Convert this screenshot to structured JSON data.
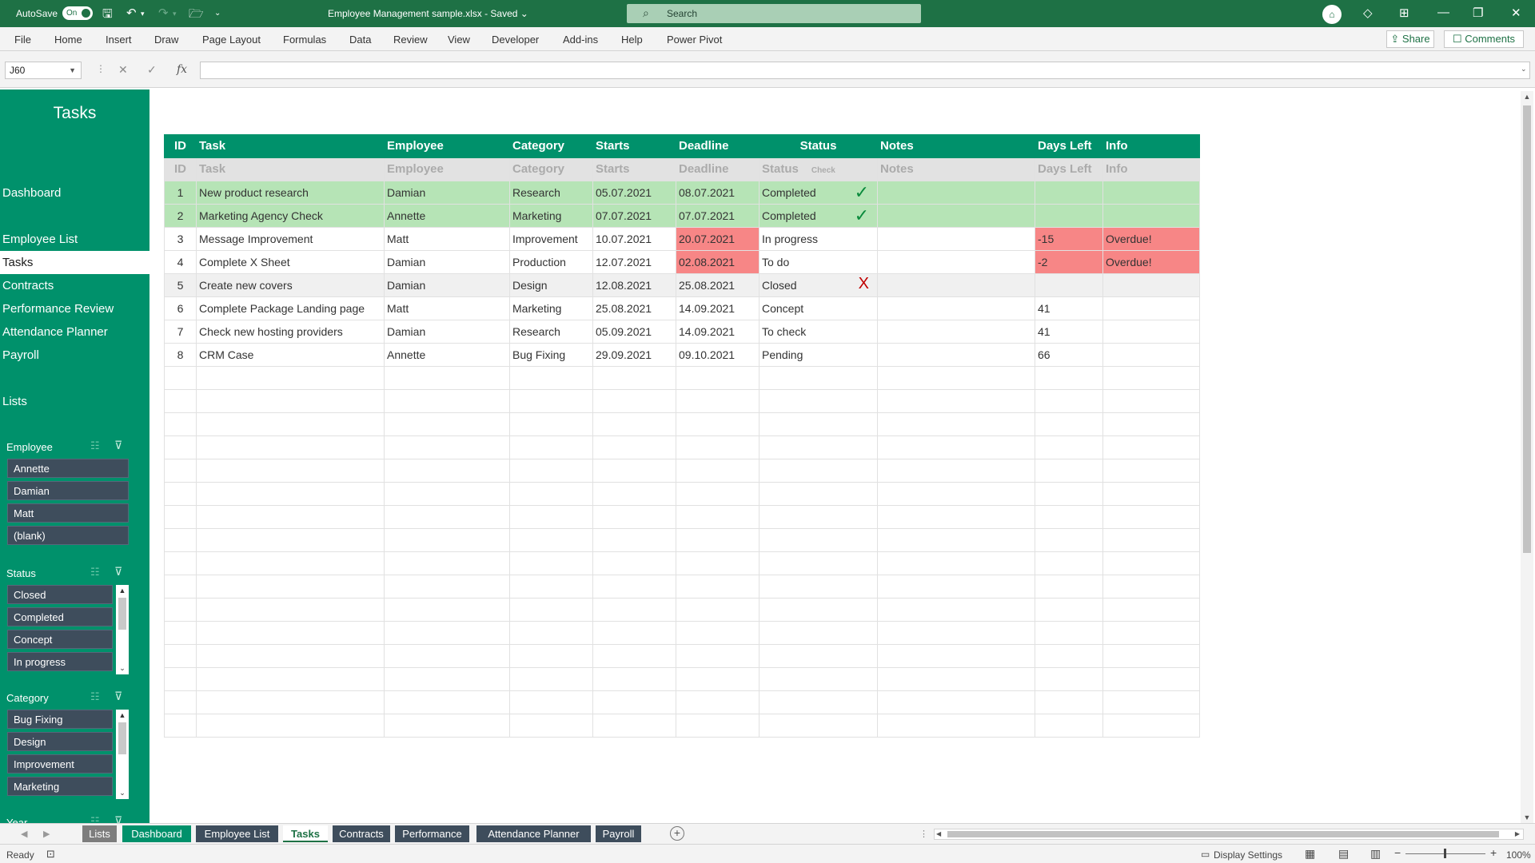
{
  "titlebar": {
    "autosave_label": "AutoSave",
    "autosave_state": "On",
    "doc_title": "Employee Management sample.xlsx  -  Saved  ⌄",
    "search_placeholder": "Search"
  },
  "menu": [
    "File",
    "Home",
    "Insert",
    "Draw",
    "Page Layout",
    "Formulas",
    "Data",
    "Review",
    "View",
    "Developer",
    "Add-ins",
    "Help",
    "Power Pivot"
  ],
  "share_label": "Share",
  "comments_label": "Comments",
  "formulabar": {
    "cell_ref": "J60",
    "fx": "fx",
    "value": ""
  },
  "sidebar": {
    "title": "Tasks",
    "nav": [
      "Dashboard",
      "Employee List",
      "Tasks",
      "Contracts",
      "Performance Review",
      "Attendance Planner",
      "Payroll",
      "Lists"
    ],
    "active": "Tasks",
    "slicers": [
      {
        "label": "Employee",
        "items": [
          "Annette",
          "Damian",
          "Matt",
          "(blank)"
        ]
      },
      {
        "label": "Status",
        "items": [
          "Closed",
          "Completed",
          "Concept",
          "In progress"
        ]
      },
      {
        "label": "Category",
        "items": [
          "Bug Fixing",
          "Design",
          "Improvement",
          "Marketing"
        ]
      },
      {
        "label": "Year",
        "items": []
      }
    ]
  },
  "table": {
    "header": {
      "id": "ID",
      "task": "Task",
      "employee": "Employee",
      "category": "Category",
      "starts": "Starts",
      "deadline": "Deadline",
      "status": "Status",
      "notes": "Notes",
      "days_left": "Days Left",
      "info": "Info"
    },
    "subheader": {
      "id": "ID",
      "task": "Task",
      "employee": "Employee",
      "category": "Category",
      "starts": "Starts",
      "deadline": "Deadline",
      "status": "Status",
      "check": "Check",
      "notes": "Notes",
      "days_left": "Days Left",
      "info": "Info"
    },
    "rows": [
      {
        "id": "1",
        "task": "New product research",
        "employee": "Damian",
        "category": "Research",
        "starts": "05.07.2021",
        "deadline": "08.07.2021",
        "status": "Completed",
        "check": "✓",
        "notes": "",
        "days_left": "",
        "info": ""
      },
      {
        "id": "2",
        "task": "Marketing Agency Check",
        "employee": "Annette",
        "category": "Marketing",
        "starts": "07.07.2021",
        "deadline": "07.07.2021",
        "status": "Completed",
        "check": "✓",
        "notes": "",
        "days_left": "",
        "info": ""
      },
      {
        "id": "3",
        "task": "Message Improvement",
        "employee": "Matt",
        "category": "Improvement",
        "starts": "10.07.2021",
        "deadline": "20.07.2021",
        "status": "In progress",
        "check": "",
        "notes": "",
        "days_left": "-15",
        "info": "Overdue!"
      },
      {
        "id": "4",
        "task": "Complete X Sheet",
        "employee": "Damian",
        "category": "Production",
        "starts": "12.07.2021",
        "deadline": "02.08.2021",
        "status": "To do",
        "check": "",
        "notes": "",
        "days_left": "-2",
        "info": "Overdue!"
      },
      {
        "id": "5",
        "task": "Create new covers",
        "employee": "Damian",
        "category": "Design",
        "starts": "12.08.2021",
        "deadline": "25.08.2021",
        "status": "Closed",
        "check": "X",
        "notes": "",
        "days_left": "",
        "info": ""
      },
      {
        "id": "6",
        "task": "Complete Package Landing page",
        "employee": "Matt",
        "category": "Marketing",
        "starts": "25.08.2021",
        "deadline": "14.09.2021",
        "status": "Concept",
        "check": "",
        "notes": "",
        "days_left": "41",
        "info": ""
      },
      {
        "id": "7",
        "task": "Check new hosting providers",
        "employee": "Damian",
        "category": "Research",
        "starts": "05.09.2021",
        "deadline": "14.09.2021",
        "status": "To check",
        "check": "",
        "notes": "",
        "days_left": "41",
        "info": ""
      },
      {
        "id": "8",
        "task": "CRM Case",
        "employee": "Annette",
        "category": "Bug Fixing",
        "starts": "29.09.2021",
        "deadline": "09.10.2021",
        "status": "Pending",
        "check": "",
        "notes": "",
        "days_left": "66",
        "info": ""
      }
    ],
    "empty_rows": 16
  },
  "tabs": [
    "Lists",
    "Dashboard",
    "Employee List",
    "Tasks",
    "Contracts",
    "Performance",
    "Attendance Planner",
    "Payroll"
  ],
  "active_tab": "Tasks",
  "status": {
    "ready": "Ready",
    "display_settings": "Display Settings",
    "zoom": "100%"
  },
  "colors": {
    "excel_green": "#1e7145",
    "sidebar": "#00916b",
    "completed_row": "#b6e4b6",
    "overdue": "#f78686",
    "slicer_btn": "#3e4d5c"
  }
}
